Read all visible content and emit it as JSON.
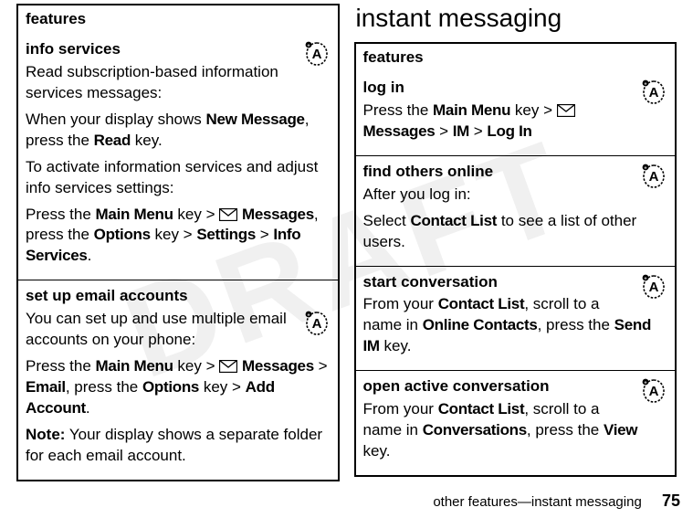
{
  "watermark": "DRAFT",
  "left": {
    "header": "features",
    "rows": [
      {
        "title": "info services",
        "body_parts": [
          {
            "t": "text",
            "v": "Read subscription-based information services messages:"
          },
          {
            "t": "break"
          },
          {
            "t": "text",
            "v": "When your display shows "
          },
          {
            "t": "ui",
            "v": "New Message"
          },
          {
            "t": "text",
            "v": ", press the "
          },
          {
            "t": "ui",
            "v": "Read"
          },
          {
            "t": "text",
            "v": " key."
          },
          {
            "t": "break"
          },
          {
            "t": "text",
            "v": "To activate information services and adjust info services settings:"
          },
          {
            "t": "break"
          },
          {
            "t": "text",
            "v": "Press the "
          },
          {
            "t": "ui",
            "v": "Main Menu"
          },
          {
            "t": "text",
            "v": " key > "
          },
          {
            "t": "env"
          },
          {
            "t": "text",
            "v": " "
          },
          {
            "t": "ui",
            "v": "Messages"
          },
          {
            "t": "text",
            "v": ", press the "
          },
          {
            "t": "ui",
            "v": "Options"
          },
          {
            "t": "text",
            "v": " key > "
          },
          {
            "t": "ui",
            "v": "Settings"
          },
          {
            "t": "text",
            "v": " > "
          },
          {
            "t": "ui",
            "v": "Info Services"
          },
          {
            "t": "text",
            "v": "."
          }
        ],
        "icon": true
      },
      {
        "title": "set up email accounts",
        "body_parts": [
          {
            "t": "text",
            "v": "You can set up and use multiple email accounts on your phone:"
          },
          {
            "t": "break"
          },
          {
            "t": "text",
            "v": "Press the "
          },
          {
            "t": "ui",
            "v": "Main Menu"
          },
          {
            "t": "text",
            "v": " key > "
          },
          {
            "t": "env"
          },
          {
            "t": "text",
            "v": " "
          },
          {
            "t": "ui",
            "v": "Messages"
          },
          {
            "t": "text",
            "v": " > "
          },
          {
            "t": "ui",
            "v": "Email"
          },
          {
            "t": "text",
            "v": ", press the "
          },
          {
            "t": "ui",
            "v": "Options"
          },
          {
            "t": "text",
            "v": " key > "
          },
          {
            "t": "ui",
            "v": "Add Account"
          },
          {
            "t": "text",
            "v": "."
          },
          {
            "t": "break"
          },
          {
            "t": "note",
            "v": "Note:"
          },
          {
            "t": "text",
            "v": " Your display shows a separate folder for each email account."
          }
        ],
        "icon": true,
        "icon_after_first_para": true
      }
    ]
  },
  "right": {
    "heading": "instant messaging",
    "header": "features",
    "rows": [
      {
        "title": "log in",
        "body_parts": [
          {
            "t": "text",
            "v": "Press the "
          },
          {
            "t": "ui",
            "v": "Main Menu"
          },
          {
            "t": "text",
            "v": " key > "
          },
          {
            "t": "env"
          },
          {
            "t": "text",
            "v": " "
          },
          {
            "t": "ui",
            "v": "Messages"
          },
          {
            "t": "text",
            "v": " > "
          },
          {
            "t": "ui",
            "v": "IM"
          },
          {
            "t": "text",
            "v": " > "
          },
          {
            "t": "ui",
            "v": "Log In"
          }
        ],
        "icon": true
      },
      {
        "title": "find others online",
        "body_parts": [
          {
            "t": "text",
            "v": "After you log in:"
          },
          {
            "t": "break"
          },
          {
            "t": "text",
            "v": "Select "
          },
          {
            "t": "ui",
            "v": "Contact List"
          },
          {
            "t": "text",
            "v": " to see a list of other users."
          }
        ],
        "icon": true
      },
      {
        "title": "start conversation",
        "body_parts": [
          {
            "t": "text",
            "v": "From your "
          },
          {
            "t": "ui",
            "v": "Contact List"
          },
          {
            "t": "text",
            "v": ", scroll to a name in "
          },
          {
            "t": "ui",
            "v": "Online Contacts"
          },
          {
            "t": "text",
            "v": ", press the "
          },
          {
            "t": "ui",
            "v": "Send IM"
          },
          {
            "t": "text",
            "v": " key."
          }
        ],
        "icon": true
      },
      {
        "title": "open active conversation",
        "body_parts": [
          {
            "t": "text",
            "v": "From your "
          },
          {
            "t": "ui",
            "v": "Contact List"
          },
          {
            "t": "text",
            "v": ", scroll to a name in "
          },
          {
            "t": "ui",
            "v": "Conversations"
          },
          {
            "t": "text",
            "v": ", press the "
          },
          {
            "t": "ui",
            "v": "View"
          },
          {
            "t": "text",
            "v": " key."
          }
        ],
        "icon": true
      }
    ]
  },
  "footer": {
    "text": "other features—instant messaging",
    "page": "75"
  }
}
